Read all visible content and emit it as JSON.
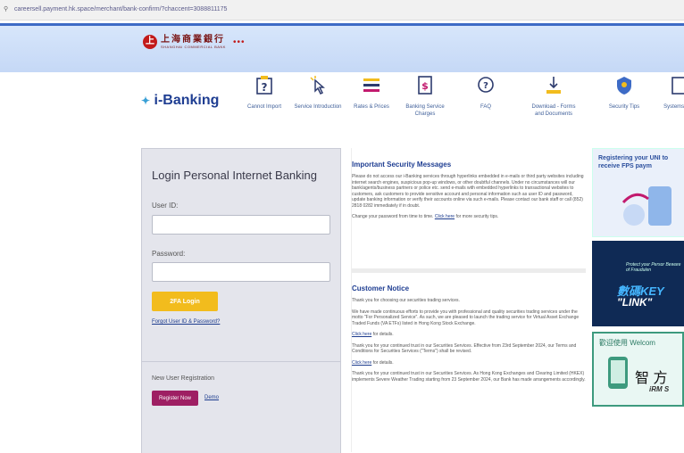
{
  "browser": {
    "url": "careersell.payment.hk.space/merchant/bank-confirm/?chaccent=3088811175"
  },
  "bank": {
    "name_cn": "上海商業銀行",
    "name_en": "SHANGHAI COMMERCIAL BANK",
    "decoration": "•••"
  },
  "nav": {
    "brand": "i-Banking",
    "items": [
      {
        "label": "Cannot Import",
        "icon": "question-icon"
      },
      {
        "label": "Service Introduction",
        "icon": "click-icon"
      },
      {
        "label": "Rates & Prices",
        "icon": "list-icon"
      },
      {
        "label": "Banking Service Charges",
        "icon": "dollar-doc-icon"
      },
      {
        "label": "FAQ",
        "icon": "faq-icon"
      },
      {
        "label": "Download - Forms and Documents",
        "icon": "download-icon"
      },
      {
        "label": "Security Tips",
        "icon": "shield-icon"
      },
      {
        "label": "Systems Sc",
        "icon": "doc-icon"
      }
    ]
  },
  "login": {
    "title": "Login Personal Internet Banking",
    "user_id_label": "User ID:",
    "user_id_value": "",
    "password_label": "Password:",
    "password_value": "",
    "login_button": "2FA Login",
    "forgot_link": "Forgot User ID & Password?",
    "new_user_label": "New User Registration",
    "register_button": "Register Now",
    "demo_link": "Demo"
  },
  "messages": {
    "security": {
      "title": "Important Security Messages",
      "body": "Please do not access our i-Banking services through hyperlinks embedded in e-mails or third party websites including internet search engines, suspicious pop-up windows, or other doubtful channels. Under no circumstances will our bank/agents/business partners or police etc. send e-mails with embedded hyperlinks to transactional websites to customers, ask customers to provide sensitive account and personal information such as user ID and password, update banking information or verify their accounts online via such e-mails. Please contact our bank staff or call (852) 2818 0282 immediately if in doubt.",
      "tip": "Change your password from time to time.",
      "tip_link": "Click here",
      "tip_tail": "for more security tips."
    },
    "notice": {
      "title": "Customer Notice",
      "p1": "Thank you for choosing our securities trading services.",
      "p2": "We have made continuous efforts to provide you with professional and quality securities trading services under the motto \"For Personalized Service\". As such, we are pleased to launch the trading service for Virtual Asset Exchange Traded Funds (VA ETFs) listed in Hong Kong Stock Exchange.",
      "p3_link": "Click here",
      "p3_tail": "for details.",
      "p4": "Thank you for your continued trust in our Securities Services. Effective from 23rd September 2024, our Terms and Conditions for Securities Services (\"Terms\") shall be revised.",
      "p5_link": "Click here",
      "p5_tail": "for details.",
      "p6": "Thank you for your continued trust in our Securities Services. As Hong Kong Exchanges and Clearing Limited (HKEX) implements Severe Weather Trading starting from 23 September 2024, our Bank has made arrangements accordingly."
    }
  },
  "ads": {
    "ad1": "Registering your UNI to receive FPS paym",
    "ad2_small": "Protect your Persor Beware of Fraudulen",
    "ad2_big1": "數碼KEY",
    "ad2_big2": "\"LINK\"",
    "ad3_top": "歡迎使用 Welcom",
    "ad3_mid": "智 方",
    "ad3_bottom": "iRM S"
  }
}
